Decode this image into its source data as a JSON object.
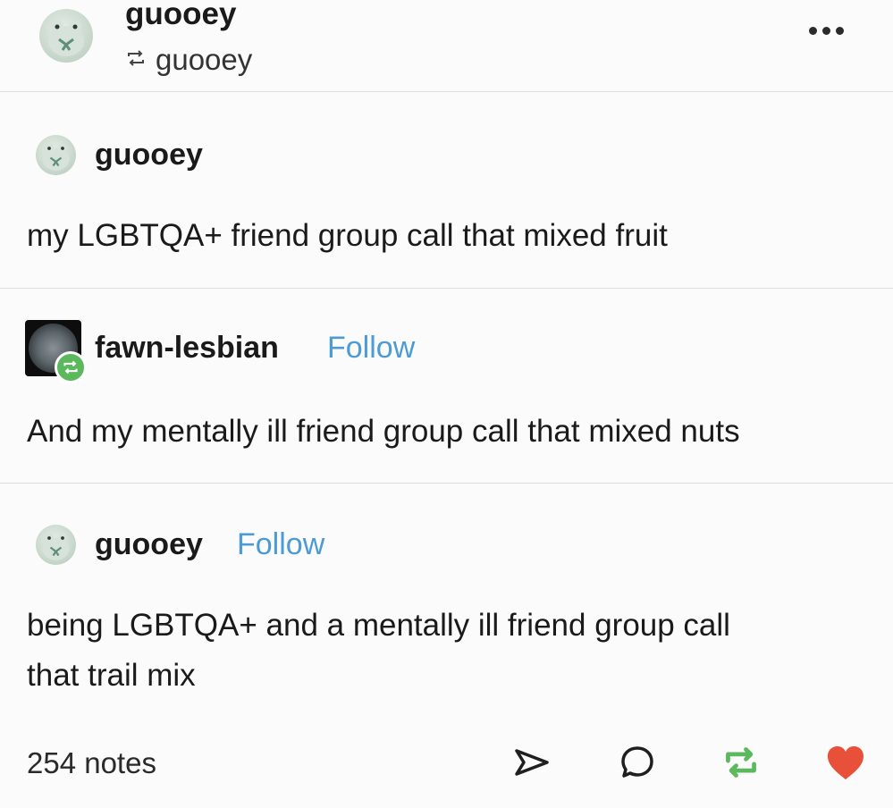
{
  "header": {
    "username": "guooey",
    "reblogged_from": "guooey",
    "menu_icon": "more-horizontal-icon"
  },
  "posts": [
    {
      "username": "guooey",
      "follow_label": "",
      "text": "my LGBTQA+ friend group call that mixed fruit"
    },
    {
      "username": "fawn-lesbian",
      "follow_label": "Follow",
      "text": "And my mentally ill friend group call that mixed nuts"
    },
    {
      "username": "guooey",
      "follow_label": "Follow",
      "text_line1": "being LGBTQA+ and a mentally ill friend group call",
      "text_line2": "that trail mix"
    }
  ],
  "footer": {
    "notes": "254 notes",
    "actions": [
      "share-icon",
      "comment-icon",
      "reblog-icon",
      "like-icon"
    ],
    "like_color": "#e8503a",
    "reblog_color": "#5cb85c"
  },
  "colors": {
    "follow": "#4d9bd5",
    "divider": "#dedede"
  }
}
